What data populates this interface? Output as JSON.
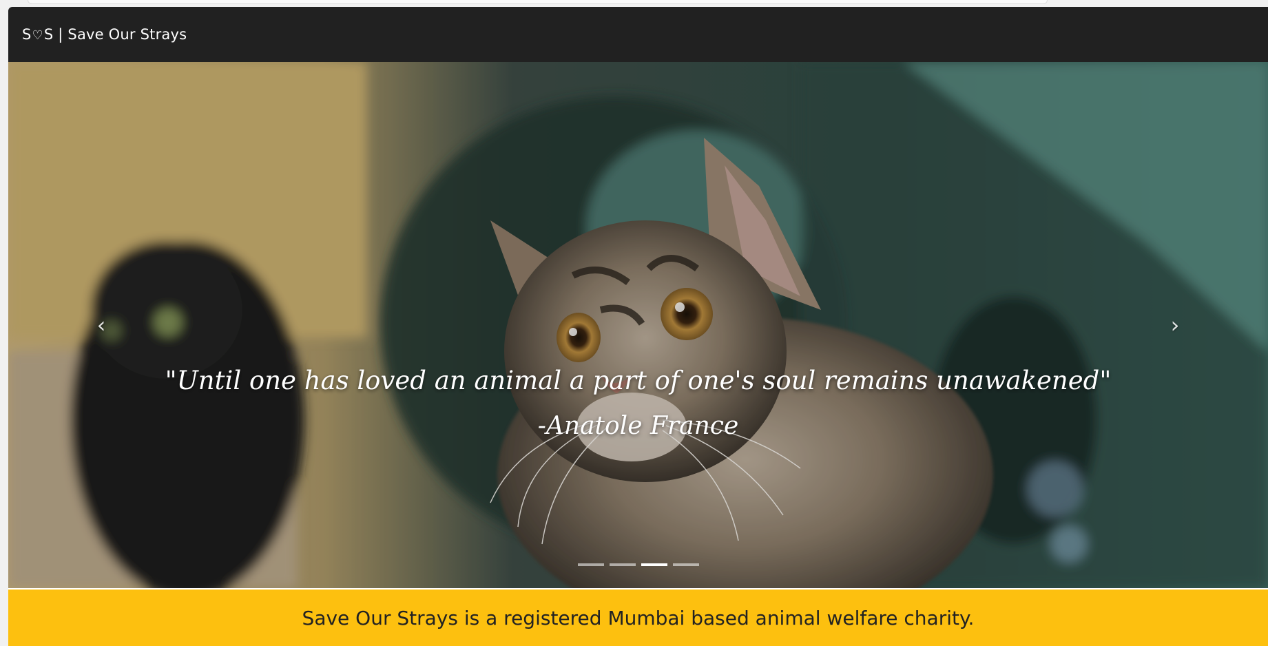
{
  "navbar": {
    "brand_prefix": "S",
    "brand_heart": "♡",
    "brand_suffix": "S | Save Our Strays"
  },
  "carousel": {
    "quote": "\"Until one has loved an animal a part of one's soul remains unawakened\"",
    "author": "-Anatole France",
    "prev_icon": "‹",
    "next_icon": "›",
    "slide_count": 4,
    "active_slide": 3
  },
  "banner": {
    "text": "Save Our Strays is a registered Mumbai based animal welfare charity."
  },
  "colors": {
    "navbar": "#212121",
    "banner": "#fdc00f"
  }
}
